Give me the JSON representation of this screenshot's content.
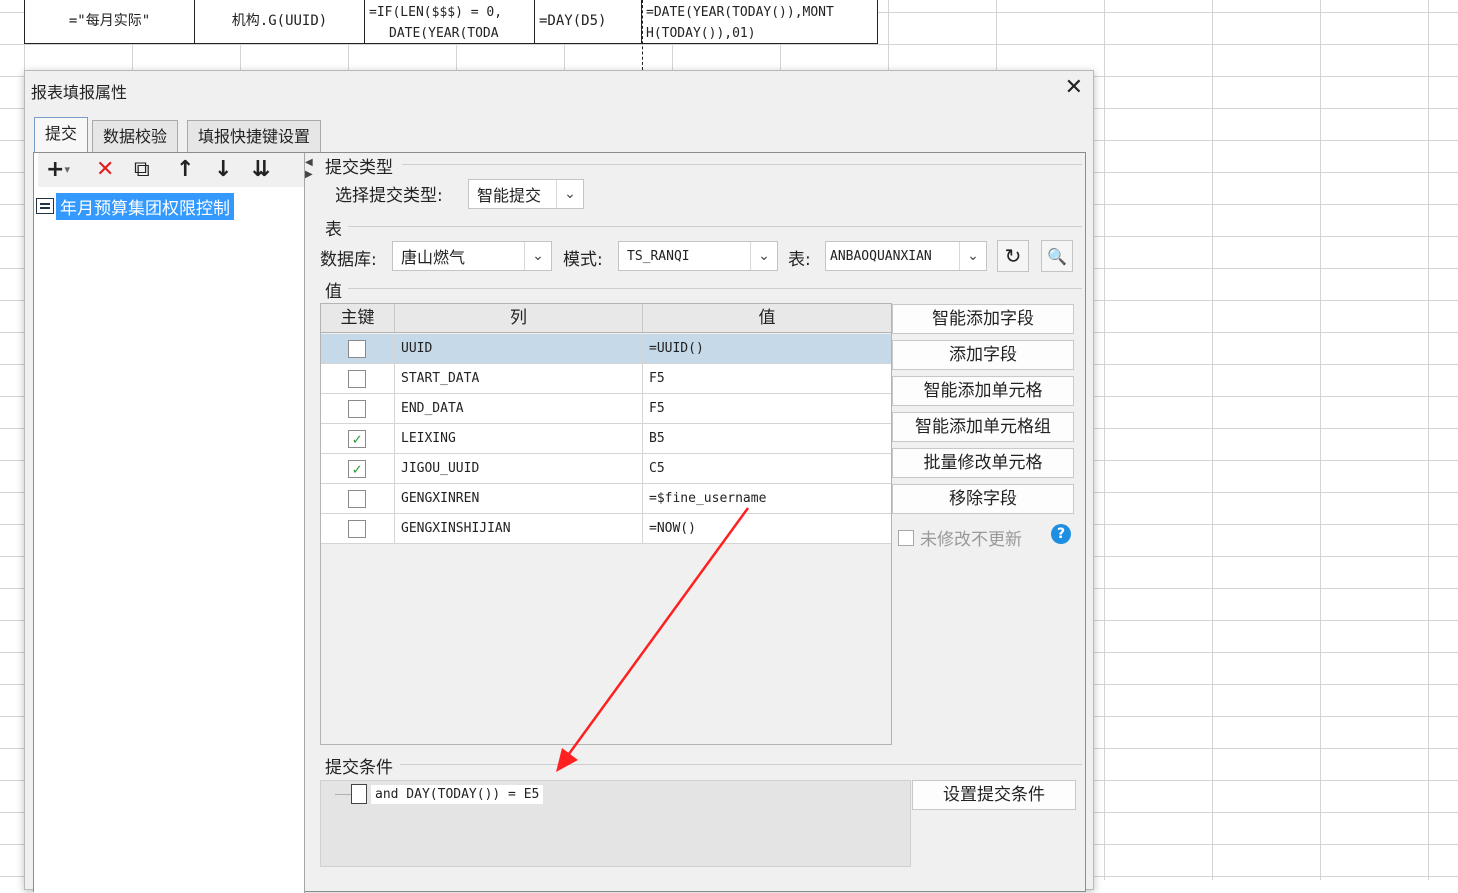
{
  "sheet": {
    "cells": [
      {
        "text": "=\"每月实际\""
      },
      {
        "text": "机构.G(UUID)"
      },
      {
        "line1": "=IF(LEN($$$) = 0,",
        "line2": "DATE(YEAR(TODA"
      },
      {
        "text": "=DAY(D5)"
      },
      {
        "line1": "=DATE(YEAR(TODAY()),MONT",
        "line2": "H(TODAY()),01)"
      }
    ]
  },
  "dialog": {
    "title": "报表填报属性",
    "close_icon": "close-icon",
    "tabs": [
      {
        "label": "提交",
        "active": true
      },
      {
        "label": "数据校验",
        "active": false
      },
      {
        "label": "填报快捷键设置",
        "active": false
      }
    ],
    "toolbar": {
      "add": "+",
      "add_caret": "▾",
      "delete": "✕",
      "copy": "⧉",
      "up": "↑",
      "down": "↓",
      "sort": "⇊"
    },
    "list": {
      "items": [
        {
          "label": "年月预算集团权限控制",
          "selected": true
        }
      ]
    },
    "submit_type": {
      "section": "提交类型",
      "label": "选择提交类型:",
      "value": "智能提交"
    },
    "table_section": {
      "section": "表",
      "db_label": "数据库:",
      "db_value": "唐山燃气",
      "schema_label": "模式:",
      "schema_value": "TS_RANQI",
      "table_label": "表:",
      "table_value": "ANBAOQUANXIAN"
    },
    "values": {
      "section": "值",
      "headers": {
        "key": "主键",
        "column": "列",
        "value": "值"
      },
      "rows": [
        {
          "column": "UUID",
          "value": "=UUID()",
          "checked": false,
          "selected": true
        },
        {
          "column": "START_DATA",
          "value": "F5",
          "checked": false
        },
        {
          "column": "END_DATA",
          "value": "F5",
          "checked": false
        },
        {
          "column": "LEIXING",
          "value": "B5",
          "checked": true
        },
        {
          "column": "JIGOU_UUID",
          "value": "C5",
          "checked": true
        },
        {
          "column": "GENGXINREN",
          "value": "=$fine_username",
          "checked": false
        },
        {
          "column": "GENGXINSHIJIAN",
          "value": "=NOW()",
          "checked": false
        }
      ],
      "check_mark": "✓"
    },
    "buttons": {
      "smart_add_field": "智能添加字段",
      "add_field": "添加字段",
      "smart_add_cell": "智能添加单元格",
      "smart_add_cell_group": "智能添加单元格组",
      "batch_modify_cell": "批量修改单元格",
      "remove_field": "移除字段",
      "no_update_unmodified": "未修改不更新",
      "help": "?"
    },
    "condition": {
      "section": "提交条件",
      "item": "and DAY(TODAY()) = E5",
      "set_button": "设置提交条件"
    }
  },
  "colors": {
    "selection_blue": "#3399ff",
    "row_selected": "#c5d9e9",
    "check_green": "#2a9a3a",
    "delete_red": "#e02020",
    "annotation_arrow": "#ff2020",
    "help_blue": "#1e8fe0"
  }
}
